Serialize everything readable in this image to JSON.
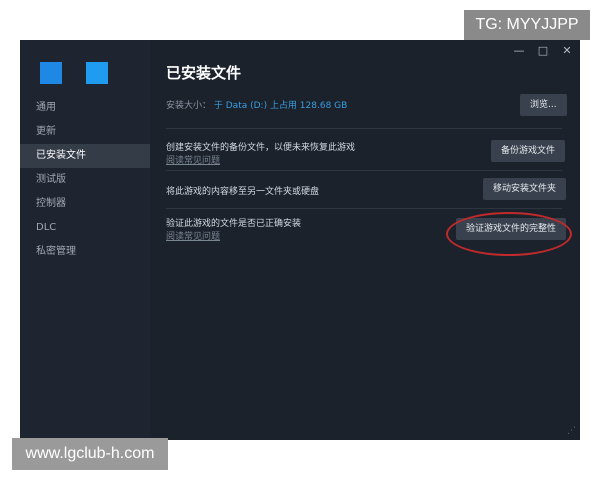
{
  "watermarks": {
    "tg": "TG: MYYJJPP",
    "site": "www.lgclub-h.com"
  },
  "window_controls": {
    "minimize": "—",
    "maximize": "□",
    "close": "✕"
  },
  "sidebar": {
    "items": [
      {
        "label": "通用"
      },
      {
        "label": "更新"
      },
      {
        "label": "已安装文件"
      },
      {
        "label": "测试版"
      },
      {
        "label": "控制器"
      },
      {
        "label": "DLC"
      },
      {
        "label": "私密管理"
      }
    ],
    "active_index": 2
  },
  "main": {
    "title": "已安装文件",
    "install_size_label": "安装大小：",
    "install_size_value": "于 Data (D:) 上占用 128.68 GB",
    "browse_label": "浏览...",
    "backup": {
      "text": "创建安装文件的备份文件，以便未来恢复此游戏",
      "link": "阅读常见问题",
      "button": "备份游戏文件"
    },
    "move": {
      "text": "将此游戏的内容移至另一文件夹或硬盘",
      "button": "移动安装文件夹"
    },
    "verify": {
      "text": "验证此游戏的文件是否已正确安装",
      "link": "阅读常见问题",
      "button": "验证游戏文件的完整性"
    }
  },
  "colors": {
    "accent_blue": "#1f88e5",
    "highlight_ring": "#c02a2a"
  }
}
